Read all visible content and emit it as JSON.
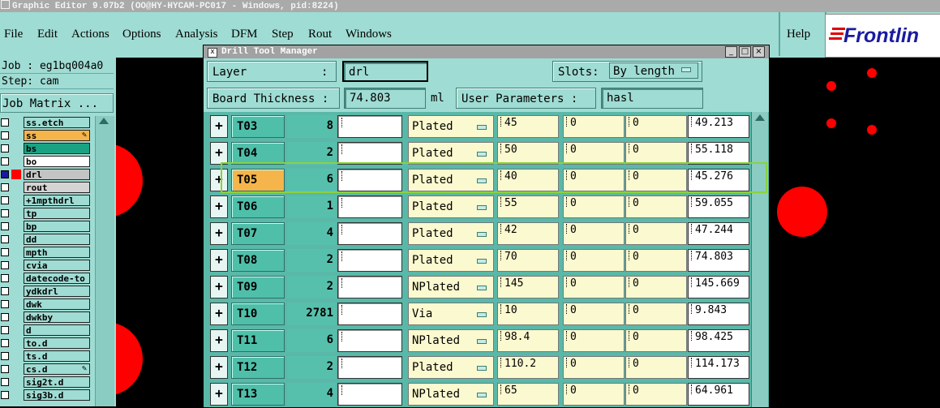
{
  "window": {
    "title": "Graphic Editor 9.07b2 (OO@HY-HYCAM-PC017 - Windows, pid:8224)"
  },
  "menu": {
    "items": [
      "File",
      "Edit",
      "Actions",
      "Options",
      "Analysis",
      "DFM",
      "Step",
      "Rout",
      "Windows"
    ],
    "help": "Help"
  },
  "logo": {
    "text": "Frontlin",
    "color": "#1a1aa0"
  },
  "left_panel": {
    "job": "Job : eg1bq004a0",
    "step": "Step: cam",
    "job_matrix": "Job Matrix ...",
    "layers": [
      {
        "name": "ss.etch",
        "color": "#9fdcd3"
      },
      {
        "name": "ss",
        "color": "#f5b54a",
        "mark": "pen"
      },
      {
        "name": "bs",
        "color": "#1aa383"
      },
      {
        "name": "bo",
        "color": "#ffffff"
      },
      {
        "name": "drl",
        "color": "#c4c4c4",
        "swatch": "#ff0000",
        "selected": true
      },
      {
        "name": "rout",
        "color": "#d4d4d4"
      },
      {
        "name": "+1mpthdrl",
        "color": "#9fdcd3"
      },
      {
        "name": "tp",
        "color": "#9fdcd3"
      },
      {
        "name": "bp",
        "color": "#9fdcd3"
      },
      {
        "name": "dd",
        "color": "#9fdcd3"
      },
      {
        "name": "mpth",
        "color": "#9fdcd3"
      },
      {
        "name": "cvia",
        "color": "#9fdcd3"
      },
      {
        "name": "datecode-to",
        "color": "#9fdcd3"
      },
      {
        "name": "ydkdrl",
        "color": "#9fdcd3"
      },
      {
        "name": "dwk",
        "color": "#9fdcd3"
      },
      {
        "name": "dwkby",
        "color": "#9fdcd3"
      },
      {
        "name": "d",
        "color": "#9fdcd3"
      },
      {
        "name": "to.d",
        "color": "#9fdcd3"
      },
      {
        "name": "ts.d",
        "color": "#9fdcd3"
      },
      {
        "name": "cs.d",
        "color": "#9fdcd3",
        "mark": "pen"
      },
      {
        "name": "sig2t.d",
        "color": "#9fdcd3"
      },
      {
        "name": "sig3b.d",
        "color": "#9fdcd3"
      }
    ]
  },
  "dialog": {
    "title": "Drill Tool Manager",
    "layer_label": "Layer",
    "layer_colon": ":",
    "layer_value": "drl",
    "slots_label": "Slots:",
    "slots_value": "By length",
    "board_thickness_label": "Board Thickness :",
    "board_thickness_value": "74.803",
    "unit": "ml",
    "user_params_label": "User Parameters :",
    "user_params_value": "hasl",
    "tools": [
      {
        "id": "T03",
        "count": "8",
        "type": "Plated",
        "v1": "45",
        "v2": "0",
        "v3": "0",
        "v4": "49.213"
      },
      {
        "id": "T04",
        "count": "2",
        "type": "Plated",
        "v1": "50",
        "v2": "0",
        "v3": "0",
        "v4": "55.118"
      },
      {
        "id": "T05",
        "count": "6",
        "type": "Plated",
        "v1": "40",
        "v2": "0",
        "v3": "0",
        "v4": "45.276",
        "selected": true
      },
      {
        "id": "T06",
        "count": "1",
        "type": "Plated",
        "v1": "55",
        "v2": "0",
        "v3": "0",
        "v4": "59.055"
      },
      {
        "id": "T07",
        "count": "4",
        "type": "Plated",
        "v1": "42",
        "v2": "0",
        "v3": "0",
        "v4": "47.244"
      },
      {
        "id": "T08",
        "count": "2",
        "type": "Plated",
        "v1": "70",
        "v2": "0",
        "v3": "0",
        "v4": "74.803"
      },
      {
        "id": "T09",
        "count": "2",
        "type": "NPlated",
        "v1": "145",
        "v2": "0",
        "v3": "0",
        "v4": "145.669"
      },
      {
        "id": "T10",
        "count": "2781",
        "type": "Via",
        "v1": "10",
        "v2": "0",
        "v3": "0",
        "v4": "9.843"
      },
      {
        "id": "T11",
        "count": "6",
        "type": "NPlated",
        "v1": "98.4",
        "v2": "0",
        "v3": "0",
        "v4": "98.425"
      },
      {
        "id": "T12",
        "count": "2",
        "type": "Plated",
        "v1": "110.2",
        "v2": "0",
        "v3": "0",
        "v4": "114.173"
      },
      {
        "id": "T13",
        "count": "4",
        "type": "NPlated",
        "v1": "65",
        "v2": "0",
        "v3": "0",
        "v4": "64.961"
      }
    ]
  },
  "colors": {
    "panel": "#9fdcd3",
    "dialog_bg": "#5ab8a8",
    "selected_tool": "#f5b54a",
    "highlight": "#8bd23c",
    "pad": "#ff0000"
  }
}
